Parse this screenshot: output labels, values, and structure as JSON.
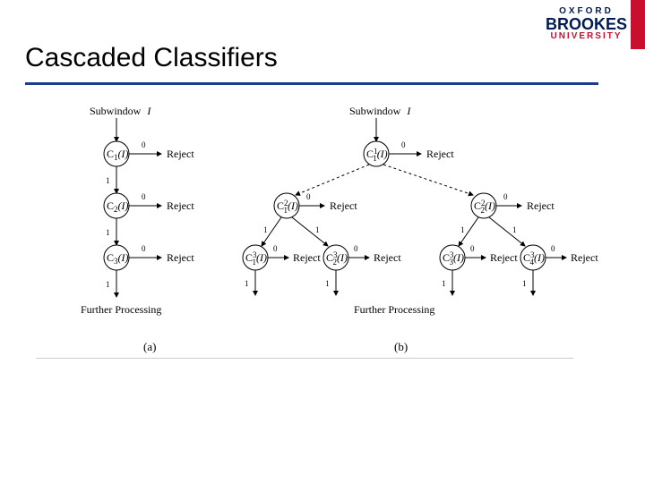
{
  "header": {
    "logo": {
      "line1": "OXFORD",
      "line2": "BROOKES",
      "line3": "UNIVERSITY"
    },
    "title": "Cascaded Classifiers"
  },
  "diagram": {
    "subwindow": "Subwindow",
    "subvar": "I",
    "reject": "Reject",
    "further": "Further Processing",
    "zero": "0",
    "one": "1",
    "nodeA": {
      "c1": "C",
      "s1": "1",
      "arg": "(I)",
      "c2": "C",
      "s2": "2",
      "c3": "C",
      "s3": "3"
    },
    "nodeB": {
      "root": {
        "c": "C",
        "sup": "1",
        "sub": "1"
      },
      "l2a": {
        "c": "C",
        "sup": "2",
        "sub": "1"
      },
      "l2b": {
        "c": "C",
        "sup": "2",
        "sub": "2"
      },
      "l3a": {
        "c": "C",
        "sup": "3",
        "sub": "1"
      },
      "l3b": {
        "c": "C",
        "sup": "3",
        "sub": "2"
      },
      "l3c": {
        "c": "C",
        "sup": "3",
        "sub": "3"
      },
      "l3d": {
        "c": "C",
        "sup": "3",
        "sub": "4"
      }
    },
    "caption_a": "(a)",
    "caption_b": "(b)"
  }
}
